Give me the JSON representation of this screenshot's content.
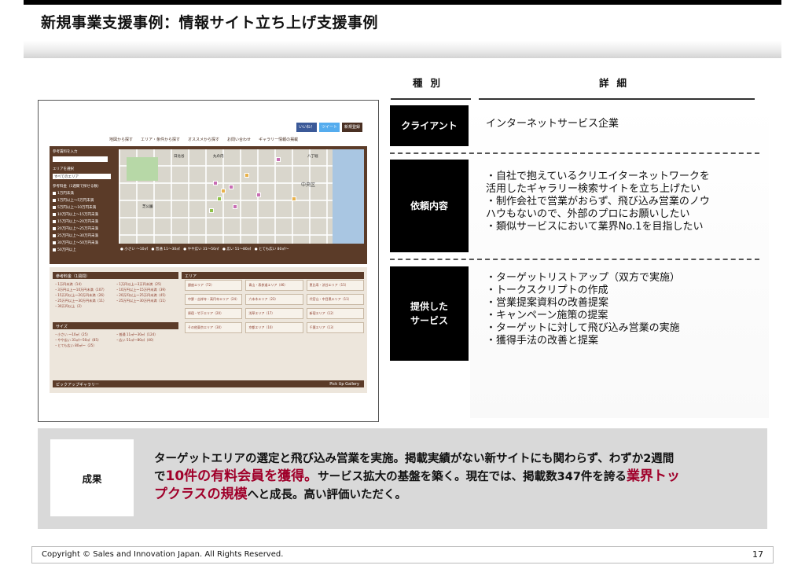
{
  "title": "新規事業支援事例：情報サイト立ち上げ支援事例",
  "columns": {
    "type": "種別",
    "detail": "詳細"
  },
  "rows": [
    {
      "label": "クライアント",
      "lines": [
        "インターネットサービス企業"
      ]
    },
    {
      "label": "依頼内容",
      "lines": [
        "・自社で抱えているクリエイターネットワークを",
        "活用したギャラリー検索サイトを立ち上げたい",
        "・制作会社で営業がおらず、飛び込み営業のノウ",
        "ハウもないので、外部のプロにお願いしたい",
        "・類似サービスにおいて業界No.1を目指したい"
      ]
    },
    {
      "label_l1": "提供した",
      "label_l2": "サービス",
      "lines": [
        "・ターゲットリストアップ（双方で実施）",
        "・トークスクリプトの作成",
        "・営業提案資料の改善提案",
        "・キャンペーン施策の提案",
        "・ターゲットに対して飛び込み営業の実施",
        "・獲得手法の改善と提案"
      ]
    }
  ],
  "result": {
    "label": "成果",
    "t1": "ターゲットエリアの選定と飛び込み営業を実施。掲載実績がない新サイトにも関わらず、わずか2週間",
    "t2": "で",
    "t3": "10件の有料会員を獲得。",
    "t4": "サービス拡大の基盤を築く。現在では、掲載数347件を誇る",
    "t5": "業界トッ",
    "t6": "プクラスの規模",
    "t7": "へと成長。高い評価いただく。"
  },
  "screenshot": {
    "buttons": [
      "いいね！",
      "ツイート",
      "新規登録"
    ],
    "nav": [
      "地図から探す",
      "エリア・条件から探す",
      "オススメから探す",
      "お問い合わせ",
      "ギャラリー情報の掲載"
    ],
    "side_title": "参考賃料を入力",
    "side_area": "エリアを選択",
    "side_area_value": "すべてのエリア",
    "side_price": "参考料金（1週間で探せる数）",
    "side_prices": [
      "1万円未満",
      "1万円以上〜5万円未満",
      "5万円以上〜10万円未満",
      "10万円以上〜15万円未満",
      "15万円以上〜20万円未満",
      "20万円以上〜25万円未満",
      "25万円以上〜30万円未満",
      "30万円以上〜50万円未満",
      "50万円以上"
    ],
    "legend": "● 小さい 〜10㎡　● 普通 11〜30㎡　● やや広い 31〜50㎡　● 広い 51〜80㎡　● とても広い 80㎡〜",
    "map_labels": [
      "日比谷",
      "丸の内",
      "八丁堀",
      "中央区",
      "芝公園"
    ],
    "sec_price": "参考料金（1週間）",
    "price_lines": [
      "・1万円未満（14）",
      "・3万円以上〜10万円未満（107）",
      "・15万円以上〜20万円未満（26）",
      "・25万円以上〜30万円未満（11）",
      "・30万円以上（2）"
    ],
    "price_lines2": [
      "・1万円以上〜3万円未満（25）",
      "・10万円以上〜15万円未満（39）",
      "・20万円以上〜25万円未満（45）",
      "・25万円以上〜30万円未満（11）"
    ],
    "sec_size": "サイズ",
    "size_lines": [
      "・小さい 〜10㎡（25）",
      "・やや広い 31㎡〜50㎡（85）",
      "・とても広い 80㎡〜（25）"
    ],
    "size_lines2": [
      "・普通 11㎡〜30㎡（124）",
      "・広い 51㎡〜80㎡（40）"
    ],
    "sec_area": "エリア",
    "areas": [
      "銀座エリア（72）",
      "青山・表参道エリア（46）",
      "恵比寿・渋谷エリア（15）",
      "中野・吉祥寺・高円寺エリア（24）",
      "六本木エリア（23）",
      "代官山・中目黒エリア（11）",
      "原宿・竹下エリア（20）",
      "浅草エリア（17）",
      "新宿エリア（12）",
      "その他東京エリア（30）",
      "京都エリア（10）",
      "千葉エリア（13）"
    ],
    "sec_pickup": "ピックアップギャラリー",
    "pickup_en": "Pick Up Gallery"
  },
  "footer": {
    "copyright": "Copyright © Sales and Innovation Japan. All Rights Reserved.",
    "page": "17"
  }
}
